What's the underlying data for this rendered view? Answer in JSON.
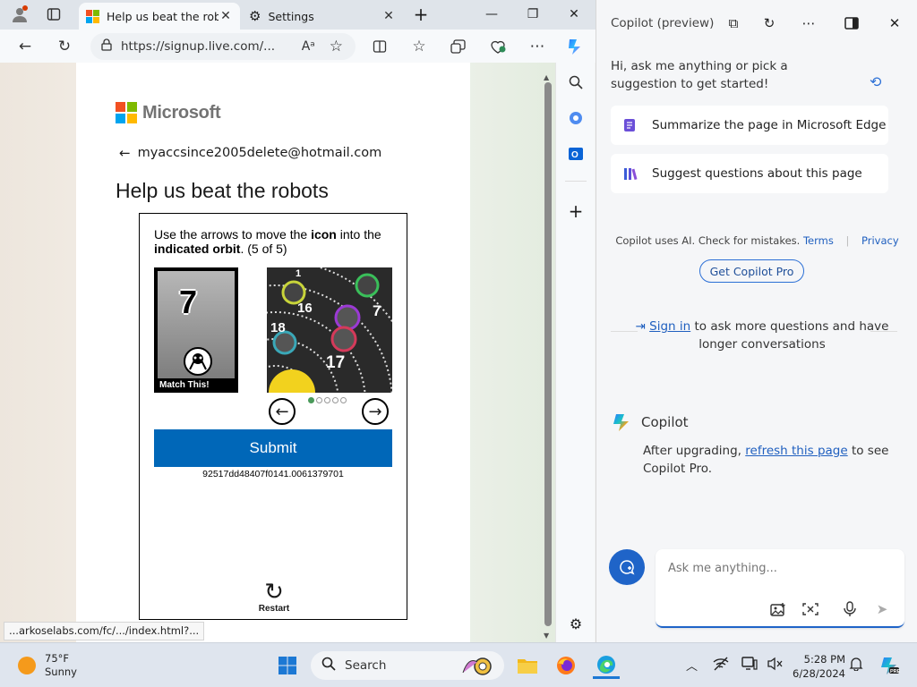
{
  "browser": {
    "tabs": [
      {
        "label": "Help us beat the robots",
        "active": true
      },
      {
        "label": "Settings",
        "active": false
      }
    ],
    "url": "https://signup.live.com/...",
    "read_aloud": "Aᵃ"
  },
  "page": {
    "brand": "Microsoft",
    "email": "myaccsince2005delete@hotmail.com",
    "title": "Help us beat the robots",
    "puzzle": {
      "instruction_prefix": "Use the arrows to move the ",
      "instruction_icon": "icon",
      "instruction_mid": " into the ",
      "instruction_orbit": "indicated orbit",
      "instruction_suffix": ". (5 of 5)",
      "match_number": "7",
      "match_caption": "Match This!",
      "orbit_numbers": [
        "1",
        "16",
        "7",
        "18",
        "17"
      ],
      "submit_label": "Submit",
      "session_id": "92517dd48407f0141.0061379701",
      "restart_label": "Restart",
      "page_dots": 5,
      "current_dot": 1
    },
    "status_link": "...arkoselabs.com/fc/.../index.html?..."
  },
  "copilot": {
    "header": "Copilot (preview)",
    "greeting": "Hi, ask me anything or pick a suggestion to get started!",
    "suggestions": [
      "Summarize the page in Microsoft Edge",
      "Suggest questions about this page"
    ],
    "note": "Copilot uses AI. Check for mistakes.",
    "terms": "Terms",
    "privacy": "Privacy",
    "pro_button": "Get Copilot Pro",
    "signin_link": "Sign in",
    "signin_rest": " to ask more questions and have longer conversations",
    "bot_name": "Copilot",
    "msg_prefix": "After upgrading, ",
    "msg_link": "refresh this page",
    "msg_suffix": " to see Copilot Pro.",
    "ask_placeholder": "Ask me anything..."
  },
  "taskbar": {
    "temp": "75°F",
    "condition": "Sunny",
    "search": "Search",
    "time": "5:28 PM",
    "date": "6/28/2024"
  },
  "colors": {
    "ms_red": "#f25022",
    "ms_green": "#7fba00",
    "ms_blue": "#00a4ef",
    "ms_yellow": "#ffb900",
    "submit_blue": "#0067b8",
    "copilot_blue": "#1f64c8"
  }
}
